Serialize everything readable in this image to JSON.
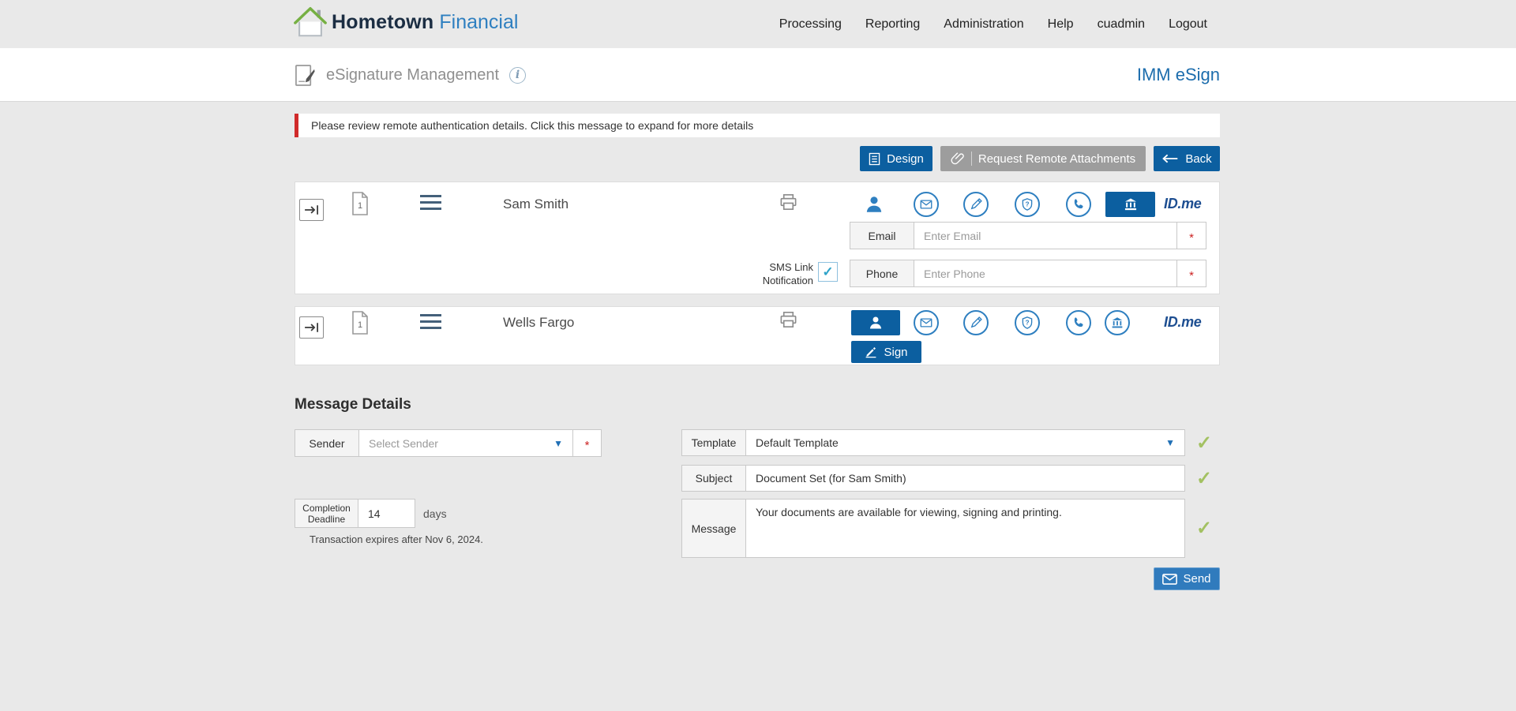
{
  "topnav": {
    "logo_main": "Hometown",
    "logo_sub": "Financial",
    "items": [
      "Processing",
      "Reporting",
      "Administration",
      "Help",
      "cuadmin",
      "Logout"
    ]
  },
  "header": {
    "title": "eSignature Management",
    "brand": "IMM eSign"
  },
  "alert": {
    "text": "Please review remote authentication details. Click this message to expand for more details"
  },
  "toolbar": {
    "design_label": "Design",
    "request_remote_label": "Request Remote Attachments",
    "back_label": "Back"
  },
  "icons": {
    "info": "i",
    "caret": "▼",
    "check": "✓",
    "required": "*",
    "idme": "ID.me"
  },
  "signers": {
    "row1": {
      "name": "Sam Smith",
      "page_count": "1",
      "email_label": "Email",
      "email_placeholder": "Enter Email",
      "sms_label": "SMS Link Notification",
      "phone_label": "Phone",
      "phone_placeholder": "Enter Phone"
    },
    "row2": {
      "name": "Wells Fargo",
      "page_count": "1",
      "sign_label": "Sign"
    }
  },
  "message_details": {
    "heading": "Message Details",
    "sender_label": "Sender",
    "sender_value": "Select Sender",
    "completion_label": "Completion Deadline",
    "completion_value": "14",
    "completion_unit": "days",
    "expires_note": "Transaction expires after Nov 6, 2024.",
    "template_label": "Template",
    "template_value": "Default Template",
    "subject_label": "Subject",
    "subject_value": "Document Set (for Sam Smith)",
    "message_label": "Message",
    "message_value": "Your documents are available for viewing, signing and printing.",
    "send_label": "Send"
  }
}
